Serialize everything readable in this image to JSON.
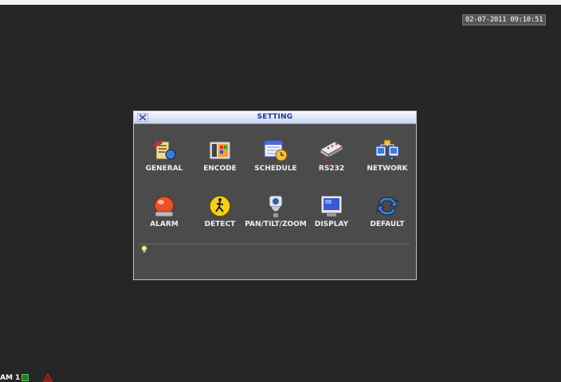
{
  "datetime": "02-07-2011 09:10:51",
  "dialog": {
    "title": "SETTING",
    "items": [
      {
        "label": "GENERAL",
        "icon": "general-icon"
      },
      {
        "label": "ENCODE",
        "icon": "encode-icon"
      },
      {
        "label": "SCHEDULE",
        "icon": "schedule-icon"
      },
      {
        "label": "RS232",
        "icon": "rs232-icon"
      },
      {
        "label": "NETWORK",
        "icon": "network-icon"
      },
      {
        "label": "ALARM",
        "icon": "alarm-icon"
      },
      {
        "label": "DETECT",
        "icon": "detect-icon"
      },
      {
        "label": "PAN/TILT/ZOOM",
        "icon": "ptz-icon"
      },
      {
        "label": "DISPLAY",
        "icon": "display-icon"
      },
      {
        "label": "DEFAULT",
        "icon": "default-icon"
      }
    ]
  },
  "channel": {
    "label": "AM 1"
  },
  "colors": {
    "background": "#262626",
    "dialog_bg": "#4b4b4b",
    "title_text": "#2430a0"
  }
}
